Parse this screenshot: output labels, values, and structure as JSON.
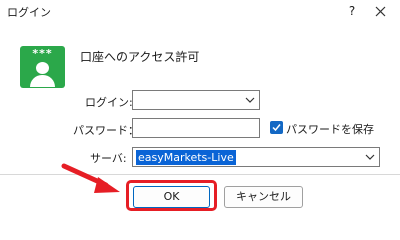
{
  "window": {
    "title": "ログイン",
    "help_label": "?"
  },
  "header": {
    "heading": "口座へのアクセス許可",
    "icon_stars": "***"
  },
  "form": {
    "login_label": "ログイン:",
    "login_value": "",
    "password_label": "パスワード：",
    "password_value": "",
    "save_password_label": "パスワードを保存",
    "save_password_checked": true,
    "server_label": "サーバ:",
    "server_value": "easyMarkets-Live"
  },
  "buttons": {
    "ok_label": "OK",
    "cancel_label": "キャンセル"
  },
  "colors": {
    "highlight": "#e61e25",
    "icon_green": "#2ba84a",
    "selection": "#0a64d6",
    "checkbox": "#1368c4"
  }
}
